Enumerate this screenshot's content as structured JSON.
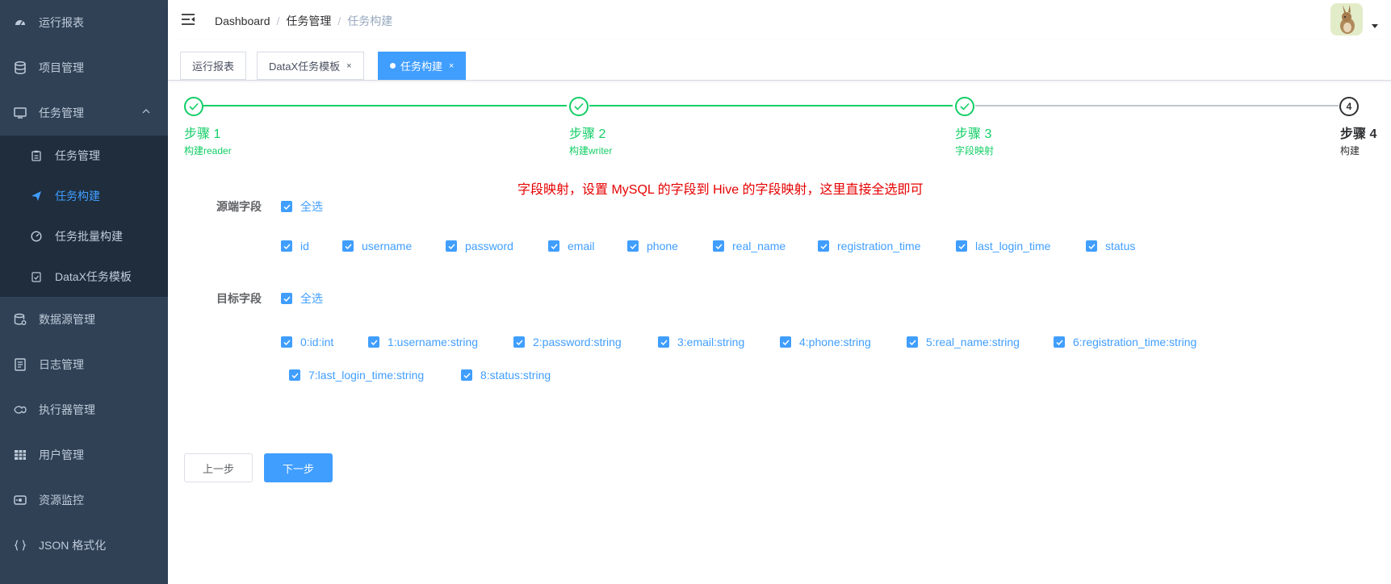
{
  "sidebar": {
    "items": [
      {
        "label": "运行报表",
        "icon": "dashboard-icon"
      },
      {
        "label": "项目管理",
        "icon": "database-icon"
      },
      {
        "label": "任务管理",
        "icon": "monitor-icon"
      },
      {
        "label": "数据源管理",
        "icon": "datasource-icon"
      },
      {
        "label": "日志管理",
        "icon": "log-icon"
      },
      {
        "label": "执行器管理",
        "icon": "executor-icon"
      },
      {
        "label": "用户管理",
        "icon": "table-icon"
      },
      {
        "label": "资源监控",
        "icon": "monitor-resource-icon"
      },
      {
        "label": "JSON 格式化",
        "icon": "json-icon"
      }
    ],
    "submenu": [
      {
        "label": "任务管理",
        "icon": "clipboard-icon"
      },
      {
        "label": "任务构建",
        "icon": "send-icon",
        "active": true
      },
      {
        "label": "任务批量构建",
        "icon": "speedometer-icon"
      },
      {
        "label": "DataX任务模板",
        "icon": "template-icon"
      }
    ]
  },
  "navbar": {
    "breadcrumb": [
      "Dashboard",
      "任务管理",
      "任务构建"
    ]
  },
  "tags": [
    {
      "label": "运行报表"
    },
    {
      "label": "DataX任务模板",
      "close": "×"
    },
    {
      "label": "任务构建",
      "close": "×",
      "active": true
    }
  ],
  "steps": [
    {
      "title": "步骤 1",
      "desc": "构建reader",
      "status": "done"
    },
    {
      "title": "步骤 2",
      "desc": "构建writer",
      "status": "done"
    },
    {
      "title": "步骤 3",
      "desc": "字段映射",
      "status": "done"
    },
    {
      "title": "步骤 4",
      "desc": "构建",
      "status": "current",
      "number": "4"
    }
  ],
  "annotation": "字段映射，设置 MySQL 的字段到 Hive 的字段映射，这里直接全选即可",
  "source": {
    "label": "源端字段",
    "select_all": "全选",
    "fields": [
      "id",
      "username",
      "password",
      "email",
      "phone",
      "real_name",
      "registration_time",
      "last_login_time",
      "status"
    ]
  },
  "target": {
    "label": "目标字段",
    "select_all": "全选",
    "fields": [
      "0:id:int",
      "1:username:string",
      "2:password:string",
      "3:email:string",
      "4:phone:string",
      "5:real_name:string",
      "6:registration_time:string",
      "7:last_login_time:string",
      "8:status:string"
    ]
  },
  "buttons": {
    "prev": "上一步",
    "next": "下一步"
  },
  "colors": {
    "sidebar_bg": "#304156",
    "submenu_bg": "#1f2d3d",
    "primary": "#409eff",
    "success": "#13ce66",
    "annotation": "#e60000"
  }
}
